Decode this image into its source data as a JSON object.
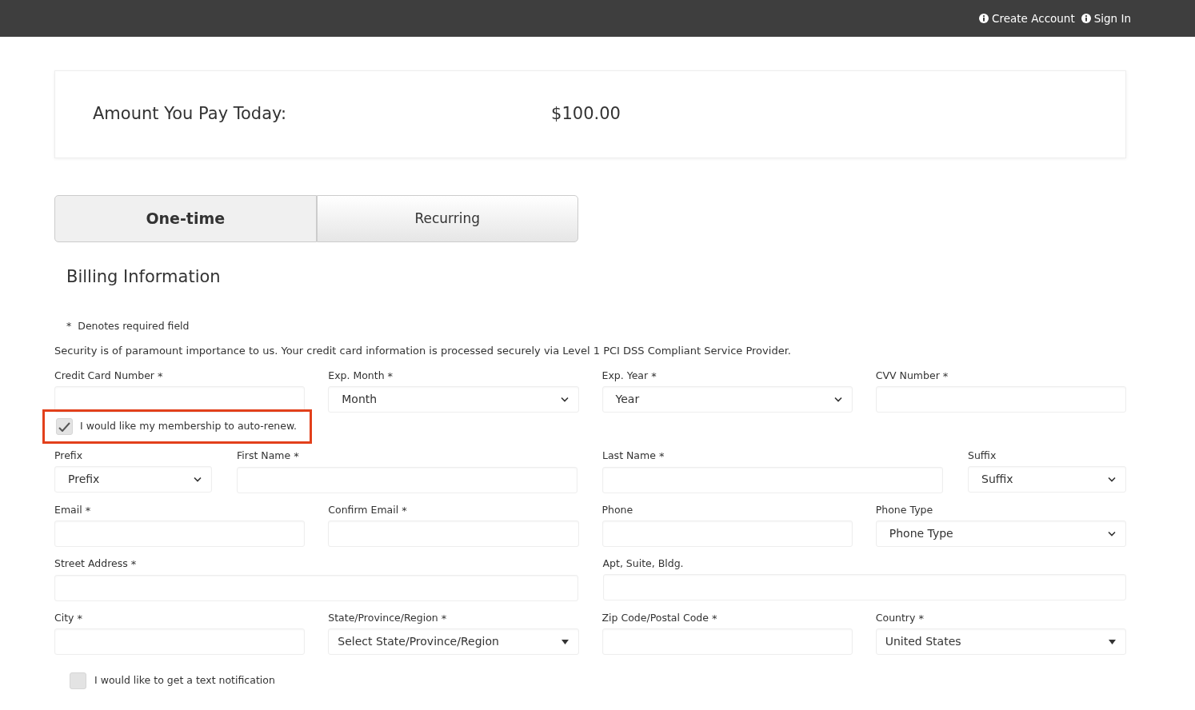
{
  "header": {
    "links": [
      {
        "label": "Create Account"
      },
      {
        "label": "Sign In"
      }
    ]
  },
  "amount": {
    "label": "Amount You Pay Today:",
    "value": "$100.00"
  },
  "tabs": [
    {
      "label": "One-time",
      "selected": true
    },
    {
      "label": "Recurring",
      "selected": false
    }
  ],
  "section_title": "Billing Information",
  "required_note": {
    "mark": "*",
    "text": "Denotes required field"
  },
  "security_text": "Security is of paramount importance to us. Your credit card information is processed securely via Level 1 PCI DSS Compliant Service Provider.",
  "payment_fields": [
    {
      "label": "Credit Card Number",
      "required_mark": "*",
      "kind": "input"
    },
    {
      "label": "Exp. Month",
      "required_mark": "*",
      "kind": "select",
      "value": "Month"
    },
    {
      "label": "Exp. Year",
      "required_mark": "*",
      "kind": "select",
      "value": "Year"
    },
    {
      "label": "CVV Number",
      "required_mark": "*",
      "kind": "input"
    }
  ],
  "auto_renew": {
    "label": "I would like my membership to auto-renew.",
    "checked": true,
    "highlighted": true
  },
  "field_rows": [
    {
      "fields": [
        {
          "label": "Prefix",
          "kind": "select",
          "value": "Prefix"
        },
        {
          "label": "First Name",
          "required_mark": "*",
          "kind": "input"
        },
        {
          "label": "Last Name",
          "required_mark": "*",
          "kind": "input"
        },
        {
          "label": "Suffix",
          "kind": "select",
          "value": "Suffix"
        }
      ]
    },
    {
      "fields": [
        {
          "label": "Email",
          "required_mark": "*",
          "kind": "input"
        },
        {
          "label": "Confirm Email",
          "required_mark": "*",
          "kind": "input"
        },
        {
          "label": "Phone",
          "kind": "input"
        },
        {
          "label": "Phone Type",
          "kind": "select",
          "value": "Phone Type"
        }
      ]
    },
    {
      "fields": [
        {
          "label": "Street Address",
          "required_mark": "*",
          "kind": "input"
        },
        {
          "label": "Apt, Suite, Bldg.",
          "kind": "input"
        }
      ]
    },
    {
      "fields": [
        {
          "label": "City",
          "required_mark": "*",
          "kind": "input"
        },
        {
          "label": "State/Province/Region",
          "required_mark": "*",
          "kind": "dropdown",
          "value": "Select State/Province/Region"
        },
        {
          "label": "Zip Code/Postal Code",
          "required_mark": "*",
          "kind": "input"
        },
        {
          "label": "Country",
          "required_mark": "*",
          "kind": "dropdown",
          "value": "United States"
        }
      ]
    }
  ],
  "text_notification": {
    "label": "I would like to get a text notification",
    "checked": false
  }
}
